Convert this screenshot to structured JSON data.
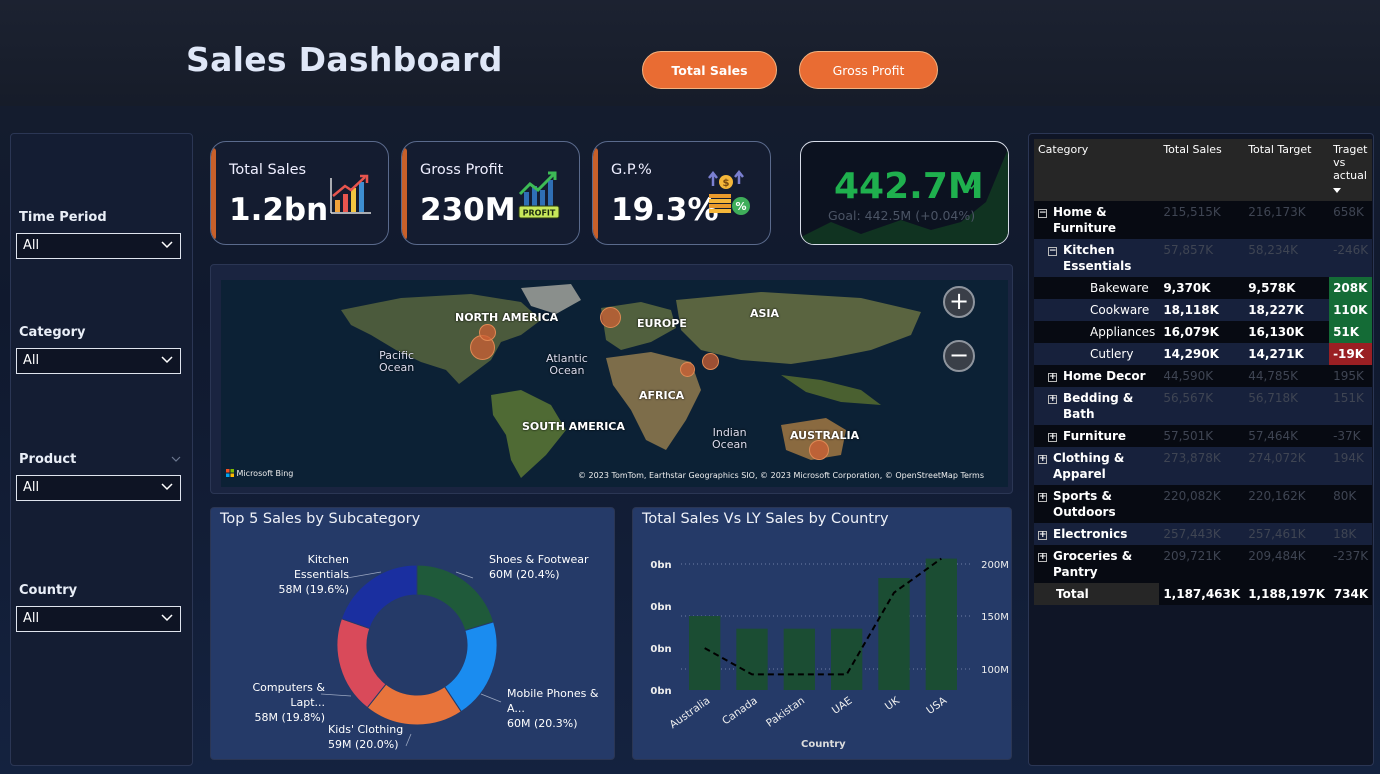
{
  "header": {
    "title": "Sales Dashboard",
    "buttons": [
      "Total Sales",
      "Gross Profit"
    ]
  },
  "slicers": [
    {
      "label": "Time Period",
      "value": "All"
    },
    {
      "label": "Category",
      "value": "All"
    },
    {
      "label": "Product",
      "value": "All"
    },
    {
      "label": "Country",
      "value": "All"
    }
  ],
  "kpis": [
    {
      "label": "Total Sales",
      "value": "1.2bn",
      "icon": "bar-chart-up-icon"
    },
    {
      "label": "Gross Profit",
      "value": "230M",
      "icon": "profit-chart-icon",
      "badge": "PROFIT"
    },
    {
      "label": "G.P.%",
      "value": "19.3%",
      "icon": "coins-percent-icon"
    }
  ],
  "goal_card": {
    "value": "442.7M",
    "goal": "Goal: 442.5M (+0.04%)"
  },
  "map": {
    "labels": {
      "north_america": "NORTH AMERICA",
      "europe": "EUROPE",
      "asia": "ASIA",
      "africa": "AFRICA",
      "south_america": "SOUTH AMERICA",
      "australia": "AUSTRALIA",
      "pacific": "Pacific\nOcean",
      "atlantic": "Atlantic\nOcean",
      "indian": "Indian\nOcean"
    },
    "credit": "© 2023 TomTom, Earthstar Geographics SIO, © 2023 Microsoft Corporation, © OpenStreetMap  Terms",
    "bing": "Microsoft Bing",
    "zoom_in": "+",
    "zoom_out": "−"
  },
  "donut": {
    "title": "Top 5 Sales by Subcategory",
    "labels": [
      {
        "name": "Kitchen Essentials",
        "value": "58M (19.6%)"
      },
      {
        "name": "Shoes & Footwear",
        "value": "60M (20.4%)"
      },
      {
        "name": "Computers & Lapt...",
        "value": "58M (19.8%)"
      },
      {
        "name": "Mobile Phones & A...",
        "value": "60M (20.3%)"
      },
      {
        "name": "Kids' Clothing",
        "value": "59M (20.0%)"
      }
    ]
  },
  "bar_combo": {
    "title": "Total Sales Vs LY Sales by Country",
    "left_ticks": [
      "0bn",
      "0bn",
      "0bn",
      "0bn"
    ],
    "right_ticks": [
      "200M",
      "150M",
      "100M"
    ],
    "xlabel": "Country"
  },
  "chart_data": [
    {
      "type": "pie",
      "title": "Top 5 Sales by Subcategory",
      "categories": [
        "Shoes & Footwear",
        "Mobile Phones & A...",
        "Kids' Clothing",
        "Computers & Lapt...",
        "Kitchen Essentials"
      ],
      "values": [
        60,
        60,
        59,
        58,
        58
      ],
      "percent": [
        20.4,
        20.3,
        20.0,
        19.8,
        19.6
      ],
      "colors": [
        "#1f5a3a",
        "#1a8cf0",
        "#e8743b",
        "#d94a5a",
        "#1a2fa0"
      ]
    },
    {
      "type": "bar",
      "title": "Total Sales Vs LY Sales by Country",
      "categories": [
        "Australia",
        "Canada",
        "Pakistan",
        "UAE",
        "UK",
        "USA"
      ],
      "series": [
        {
          "values": [
            146,
            133,
            133,
            133,
            185,
            205
          ],
          "color": "#1b4d33"
        },
        {
          "values": [
            113,
            86,
            86,
            86,
            170,
            205
          ],
          "color": "#000000"
        }
      ],
      "xlabel": "Country",
      "ylim": [
        70,
        220
      ]
    }
  ],
  "table": {
    "headers": [
      "Category",
      "Total Sales",
      "Total Target",
      "Traget vs actual"
    ],
    "rows": [
      {
        "level": 0,
        "exp": "−",
        "name": "Home & Furniture",
        "sales": "215,515K",
        "target": "216,173K",
        "diff": "658K",
        "style": "r-black",
        "dim": true
      },
      {
        "level": 1,
        "exp": "−",
        "name": "Kitchen Essentials",
        "sales": "57,857K",
        "target": "58,234K",
        "diff": "-246K",
        "style": "r-blue",
        "dim": true
      },
      {
        "level": 2,
        "exp": "",
        "name": "Bakeware",
        "sales": "9,370K",
        "target": "9,578K",
        "diff": "208K",
        "style": "r-black",
        "dim": false,
        "tone": "pos"
      },
      {
        "level": 2,
        "exp": "",
        "name": "Cookware",
        "sales": "18,118K",
        "target": "18,227K",
        "diff": "110K",
        "style": "r-blue",
        "dim": false,
        "tone": "pos"
      },
      {
        "level": 2,
        "exp": "",
        "name": "Appliances",
        "sales": "16,079K",
        "target": "16,130K",
        "diff": "51K",
        "style": "r-black",
        "dim": false,
        "tone": "pos"
      },
      {
        "level": 2,
        "exp": "",
        "name": "Cutlery",
        "sales": "14,290K",
        "target": "14,271K",
        "diff": "-19K",
        "style": "r-blue",
        "dim": false,
        "tone": "neg"
      },
      {
        "level": 1,
        "exp": "+",
        "name": "Home Decor",
        "sales": "44,590K",
        "target": "44,785K",
        "diff": "195K",
        "style": "r-black",
        "dim": true
      },
      {
        "level": 1,
        "exp": "+",
        "name": "Bedding & Bath",
        "sales": "56,567K",
        "target": "56,718K",
        "diff": "151K",
        "style": "r-blue",
        "dim": true
      },
      {
        "level": 1,
        "exp": "+",
        "name": "Furniture",
        "sales": "57,501K",
        "target": "57,464K",
        "diff": "-37K",
        "style": "r-black",
        "dim": true
      },
      {
        "level": 0,
        "exp": "+",
        "name": "Clothing & Apparel",
        "sales": "273,878K",
        "target": "274,072K",
        "diff": "194K",
        "style": "r-blue",
        "dim": true
      },
      {
        "level": 0,
        "exp": "+",
        "name": "Sports & Outdoors",
        "sales": "220,082K",
        "target": "220,162K",
        "diff": "80K",
        "style": "r-black",
        "dim": true
      },
      {
        "level": 0,
        "exp": "+",
        "name": "Electronics",
        "sales": "257,443K",
        "target": "257,461K",
        "diff": "18K",
        "style": "r-blue",
        "dim": true
      },
      {
        "level": 0,
        "exp": "+",
        "name": "Groceries & Pantry",
        "sales": "209,721K",
        "target": "209,484K",
        "diff": "-237K",
        "style": "r-black",
        "dim": true
      }
    ],
    "total": {
      "name": "Total",
      "sales": "1,187,463K",
      "target": "1,188,197K",
      "diff": "734K"
    }
  },
  "colors": {
    "accent": "#e96c33",
    "positive": "#146b36",
    "negative": "#9a1f23",
    "goal": "#1fb04e"
  }
}
